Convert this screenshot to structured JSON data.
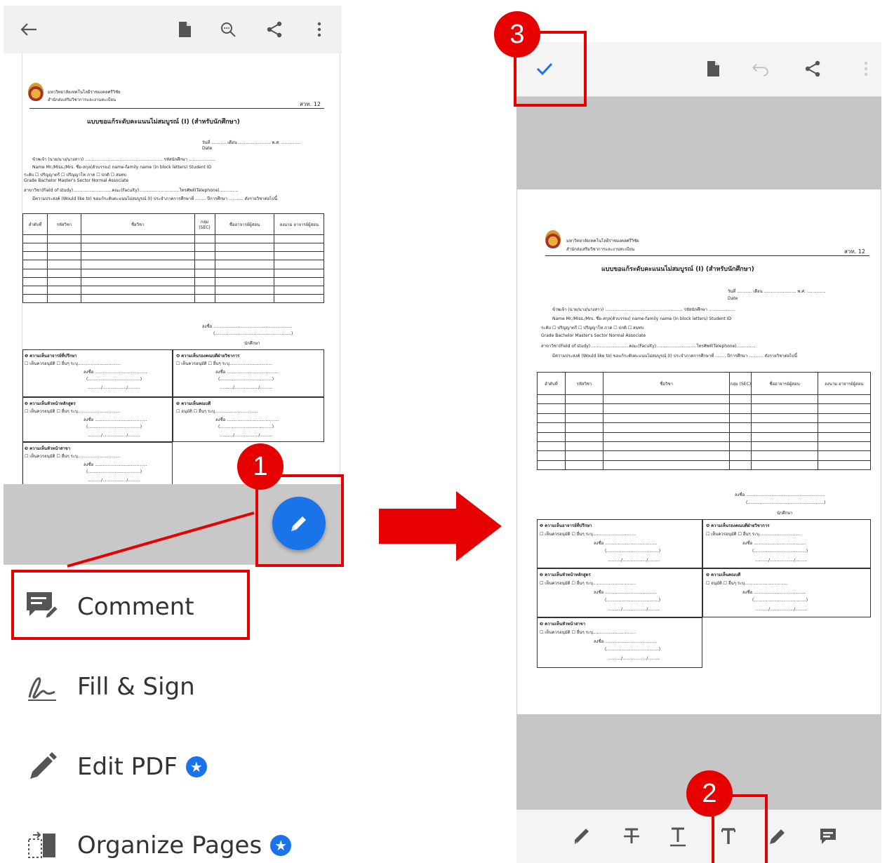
{
  "left": {
    "menu": [
      {
        "label": "Comment",
        "icon": "comment-icon",
        "premium": false
      },
      {
        "label": "Fill & Sign",
        "icon": "fill-sign-icon",
        "premium": false
      },
      {
        "label": "Edit PDF",
        "icon": "edit-pdf-icon",
        "premium": true
      },
      {
        "label": "Organize Pages",
        "icon": "organize-pages-icon",
        "premium": true
      }
    ]
  },
  "document": {
    "university": "มหาวิทยาลัยเทคโนโลยีราชมงคลศรีวิชัย",
    "office": "สำนักส่งเสริมวิชาการและงานทะเบียน",
    "form_code": "สวท. 12",
    "title": "แบบขอแก้ระดับคะแนนไม่สมบูรณ์ (I) (สำหรับนักศึกษา)",
    "date_line": "วันที่ ........... เดือน ........................ พ.ศ. ..............",
    "date_en": "Date",
    "name_line_th": "ข้าพเจ้า (นาย/นาง/นางสาว) .......................................................... รหัสนักศึกษา ....................",
    "name_line_en": "Name  Mr./Miss./Mrs.   ชื่อ-สกุล(ตัวบรรจง) name-family name (in block letters)   Student ID",
    "level_line_th": "ระดับ  ☐ ปริญญาตรี  ☐ ปริญญาโท      ภาค   ☐ ปกติ      ☐ สมทบ",
    "level_line_en": "Grade      Bachelor          Master's           Sector      Normal        Associate",
    "field_line": "สาขาวิชา(Field of study).............................คณะ(Faculty)..............................โทรศัพท์(Telephone)..............",
    "purpose_line": "มีความประสงค์ (Would like to) ขอแก้ระดับคะแนนไม่สมบูรณ์ (I) ประจำภาคการศึกษาที่ ........ ปีการศึกษา ........... ดังรายวิชาต่อไปนี้",
    "table_headers": [
      "ลำดับที่",
      "รหัสวิชา",
      "ชื่อวิชา",
      "กลุ่ม (SEC)",
      "ชื่ออาจารย์ผู้สอน",
      "ลงนาม อาจารย์ผู้สอน"
    ],
    "sign_line": "ลงชื่อ ...........................................................",
    "sign_paren": "(.........................................................)",
    "student_label": "นักศึกษา",
    "sections": [
      {
        "title": "❶ ความเห็นอาจารย์ที่ปรึกษา",
        "options": "☐ เห็นควรอนุมัติ     ☐ อื่นๆ ระบุ................................"
      },
      {
        "title": "❷ ความเห็นหัวหน้าหลักสูตร",
        "options": "☐ เห็นควรอนุมัติ     ☐ อื่นๆ ระบุ................................"
      },
      {
        "title": "❸ ความเห็นหัวหน้าสาขา",
        "options": "☐ เห็นควรอนุมัติ     ☐ อื่นๆ ระบุ................................"
      },
      {
        "title": "❹ ความเห็นรองคณบดีฝ่ายวิชาการ",
        "options": "☐ เห็นควรอนุมัติ     ☐ อื่นๆ ระบุ................................"
      },
      {
        "title": "❺ ความเห็นคณบดี",
        "options": "☐ อนุมัติ     ☐ อื่นๆ ระบุ................................"
      }
    ],
    "sec_sign": "ลงชื่อ .......................................",
    "sec_paren": "(.......................................)",
    "sec_date": "........../................../........."
  },
  "annotations": {
    "step1": "1",
    "step2": "2",
    "step3": "3"
  },
  "colors": {
    "annotation_red": "#e60000",
    "fab_blue": "#1a73e8",
    "check_blue": "#1a73e8"
  }
}
